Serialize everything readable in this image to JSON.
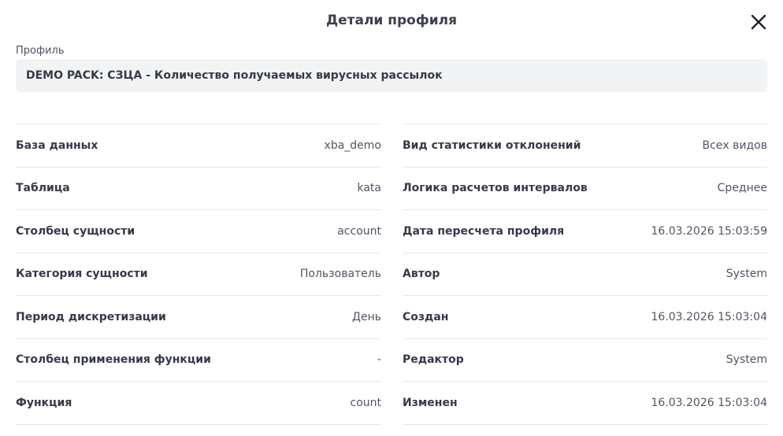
{
  "modal": {
    "title": "Детали профиля"
  },
  "profile": {
    "label": "Профиль",
    "value": "DEMO PACK: СЗЦА - Количество получаемых вирусных рассылок"
  },
  "left_rows": [
    {
      "key": "База данных",
      "value": "xba_demo"
    },
    {
      "key": "Таблица",
      "value": "kata"
    },
    {
      "key": "Столбец сущности",
      "value": "account"
    },
    {
      "key": "Категория сущности",
      "value": "Пользователь"
    },
    {
      "key": "Период дискретизации",
      "value": "День"
    },
    {
      "key": "Столбец применения функции",
      "value": "-"
    },
    {
      "key": "Функция",
      "value": "count"
    }
  ],
  "right_rows": [
    {
      "key": "Вид статистики отклонений",
      "value": "Всех видов"
    },
    {
      "key": "Логика расчетов интервалов",
      "value": "Среднее"
    },
    {
      "key": "Дата пересчета профиля",
      "value": "16.03.2026 15:03:59"
    },
    {
      "key": "Автор",
      "value": "System"
    },
    {
      "key": "Создан",
      "value": "16.03.2026 15:03:04"
    },
    {
      "key": "Редактор",
      "value": "System"
    },
    {
      "key": "Изменен",
      "value": "16.03.2026 15:03:04"
    }
  ],
  "icons": {
    "close": "close-icon"
  }
}
